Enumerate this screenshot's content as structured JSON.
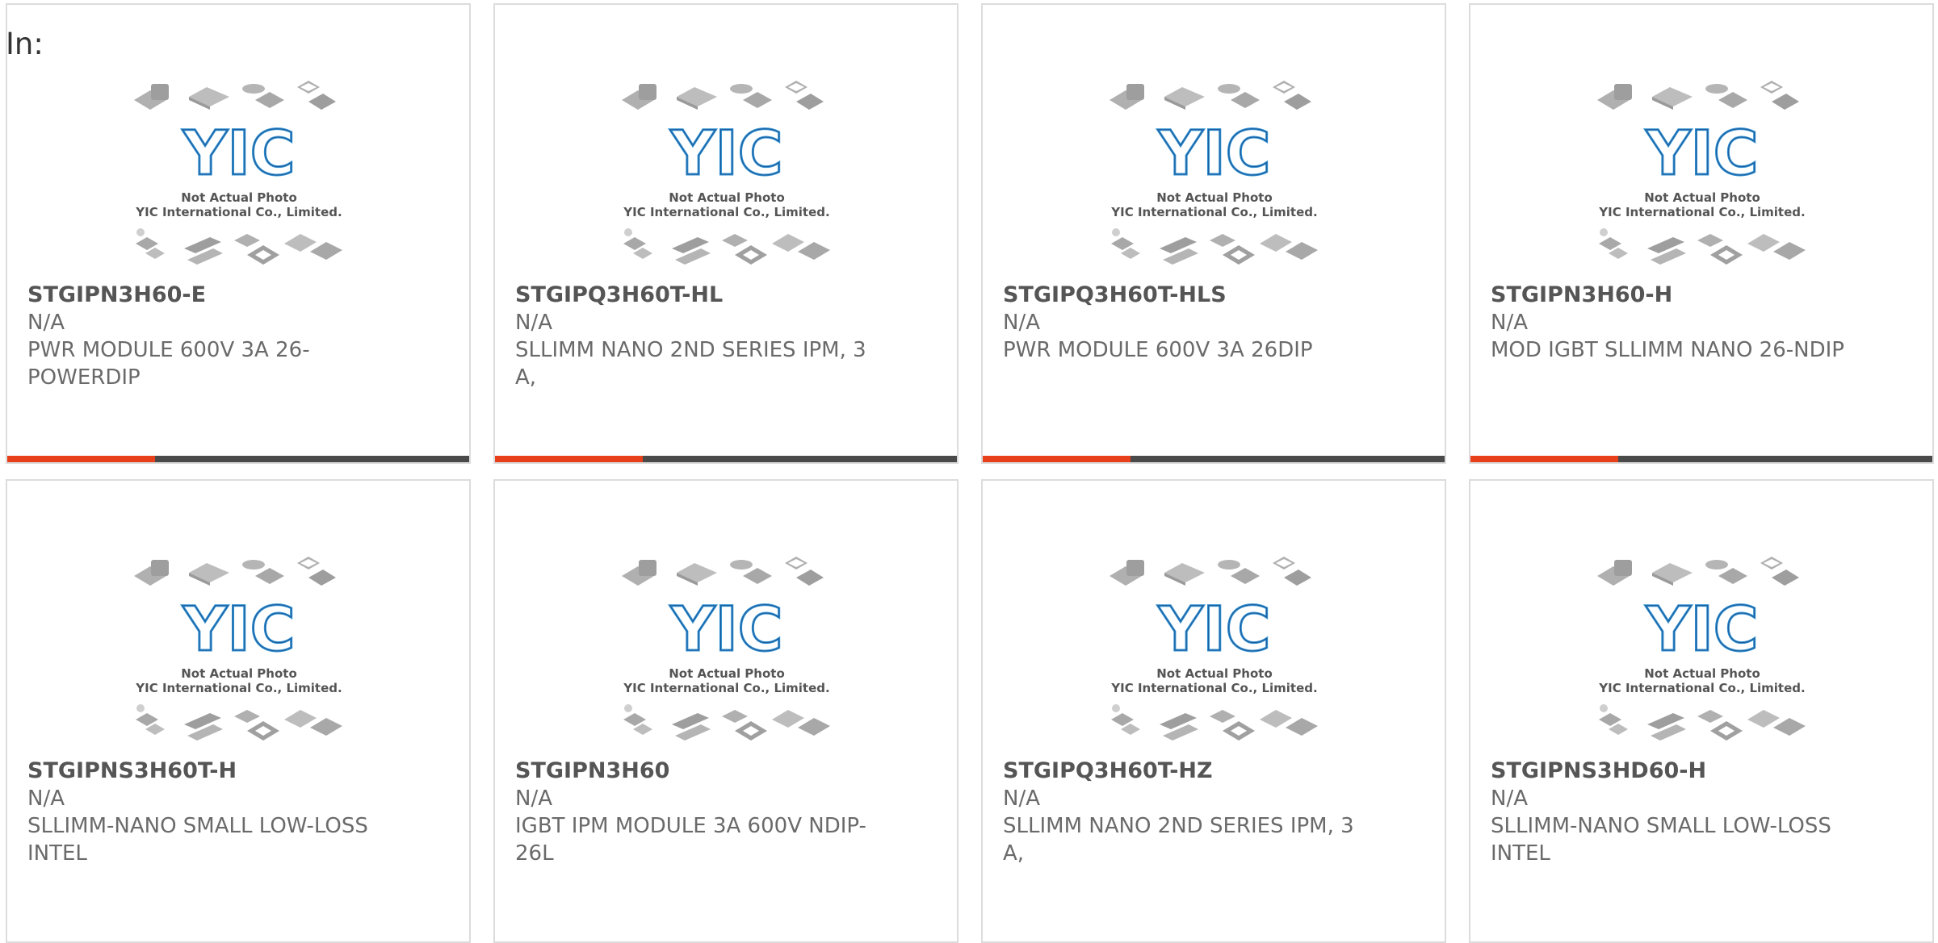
{
  "header": {
    "in_label": "In:"
  },
  "image_caption": {
    "line1": "Not Actual Photo",
    "line2": "YIC International Co., Limited.",
    "logo": "YIC"
  },
  "accent_color": "#e8401a",
  "products": [
    {
      "part_number": "STGIPN3H60-E",
      "manufacturer": "N/A",
      "description": "PWR MODULE 600V 3A 26-POWERDIP"
    },
    {
      "part_number": "STGIPQ3H60T-HL",
      "manufacturer": "N/A",
      "description": "SLLIMM NANO 2ND SERIES IPM, 3 A,"
    },
    {
      "part_number": "STGIPQ3H60T-HLS",
      "manufacturer": "N/A",
      "description": "PWR MODULE 600V 3A 26DIP"
    },
    {
      "part_number": "STGIPN3H60-H",
      "manufacturer": "N/A",
      "description": "MOD IGBT SLLIMM NANO 26-NDIP"
    },
    {
      "part_number": "STGIPNS3H60T-H",
      "manufacturer": "N/A",
      "description": "SLLIMM-NANO SMALL LOW-LOSS INTEL"
    },
    {
      "part_number": "STGIPN3H60",
      "manufacturer": "N/A",
      "description": "IGBT IPM MODULE 3A 600V NDIP-26L"
    },
    {
      "part_number": "STGIPQ3H60T-HZ",
      "manufacturer": "N/A",
      "description": "SLLIMM NANO 2ND SERIES IPM, 3 A,"
    },
    {
      "part_number": "STGIPNS3HD60-H",
      "manufacturer": "N/A",
      "description": "SLLIMM-NANO SMALL LOW-LOSS INTEL"
    }
  ]
}
